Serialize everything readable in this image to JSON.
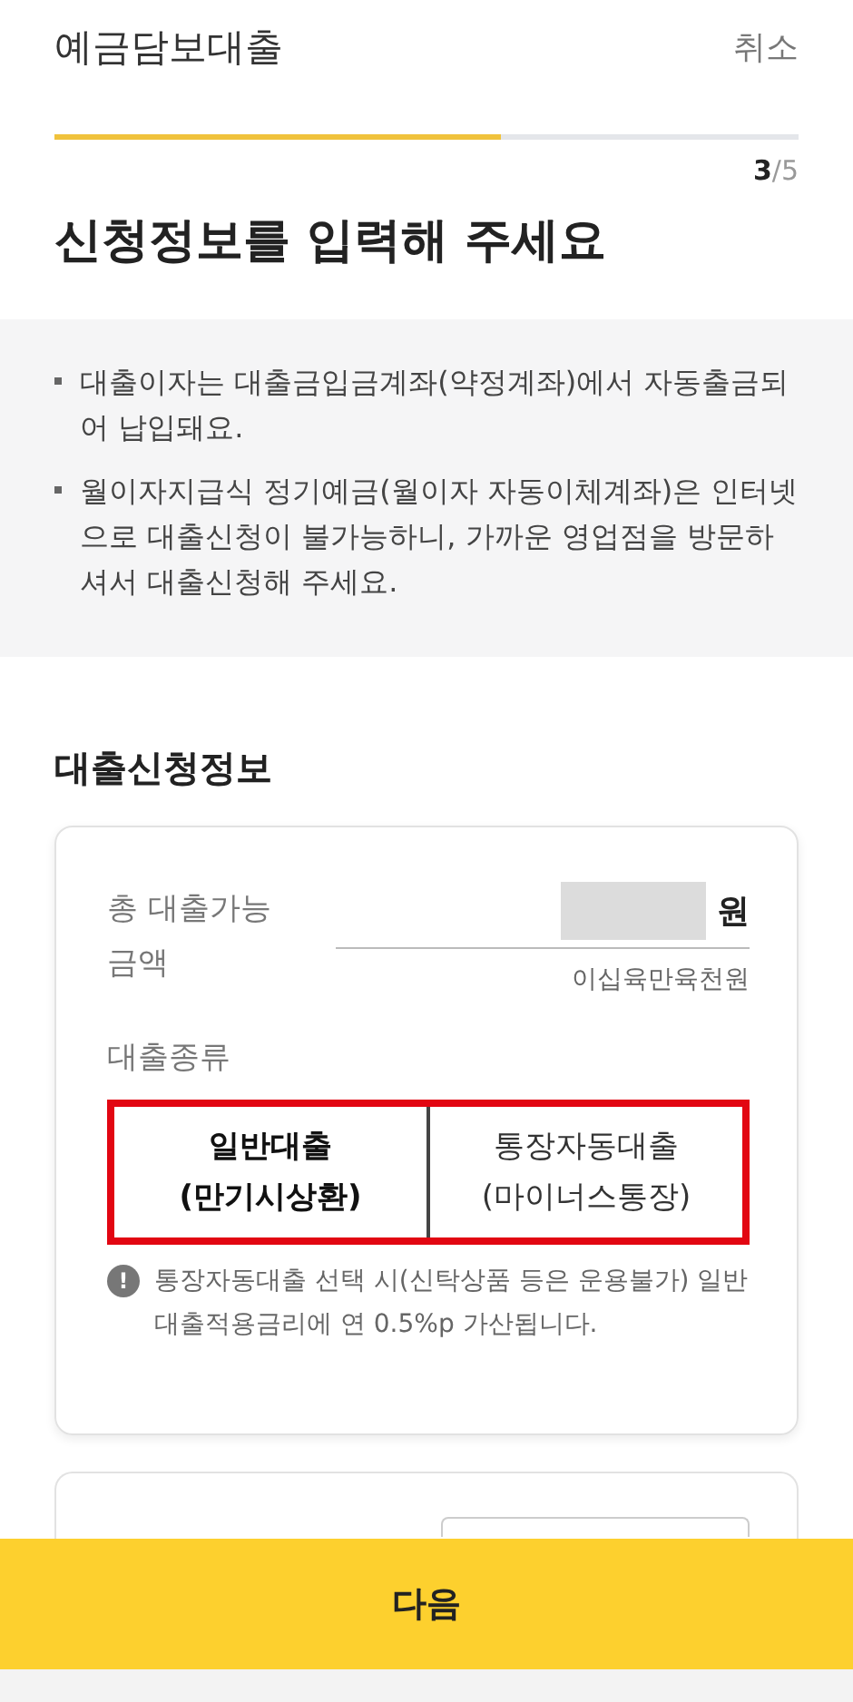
{
  "header": {
    "title": "예금담보대출",
    "cancel": "취소"
  },
  "progress": {
    "level": 0.6,
    "current": "3",
    "total": "/5"
  },
  "heading": "신청정보를 입력해 주세요",
  "notices": [
    "대출이자는 대출금입금계좌(약정계좌)에서 자동출금되어 납입돼요.",
    "월이자지급식 정기예금(월이자 자동이체계좌)은 인터넷으로 대출신청이 불가능하니, 가까운 영업점을 방문하셔서 대출신청해 주세요."
  ],
  "section_title": "대출신청정보",
  "amount": {
    "label": "총 대출가능\n금액",
    "masked": true,
    "unit": "원",
    "in_words": "이십육만육천원"
  },
  "loan_type": {
    "label": "대출종류",
    "highlighted": true,
    "options": [
      {
        "line1": "일반대출",
        "line2": "(만기시상환)",
        "selected": true
      },
      {
        "line1": "통장자동대출",
        "line2": "(마이너스통장)",
        "selected": false
      }
    ],
    "note_icon": "!",
    "note": "통장자동대출 선택 시(신탁상품 등은 운용불가) 일반대출적용금리에 연 0.5%p 가산됩니다."
  },
  "next_button": "다음"
}
